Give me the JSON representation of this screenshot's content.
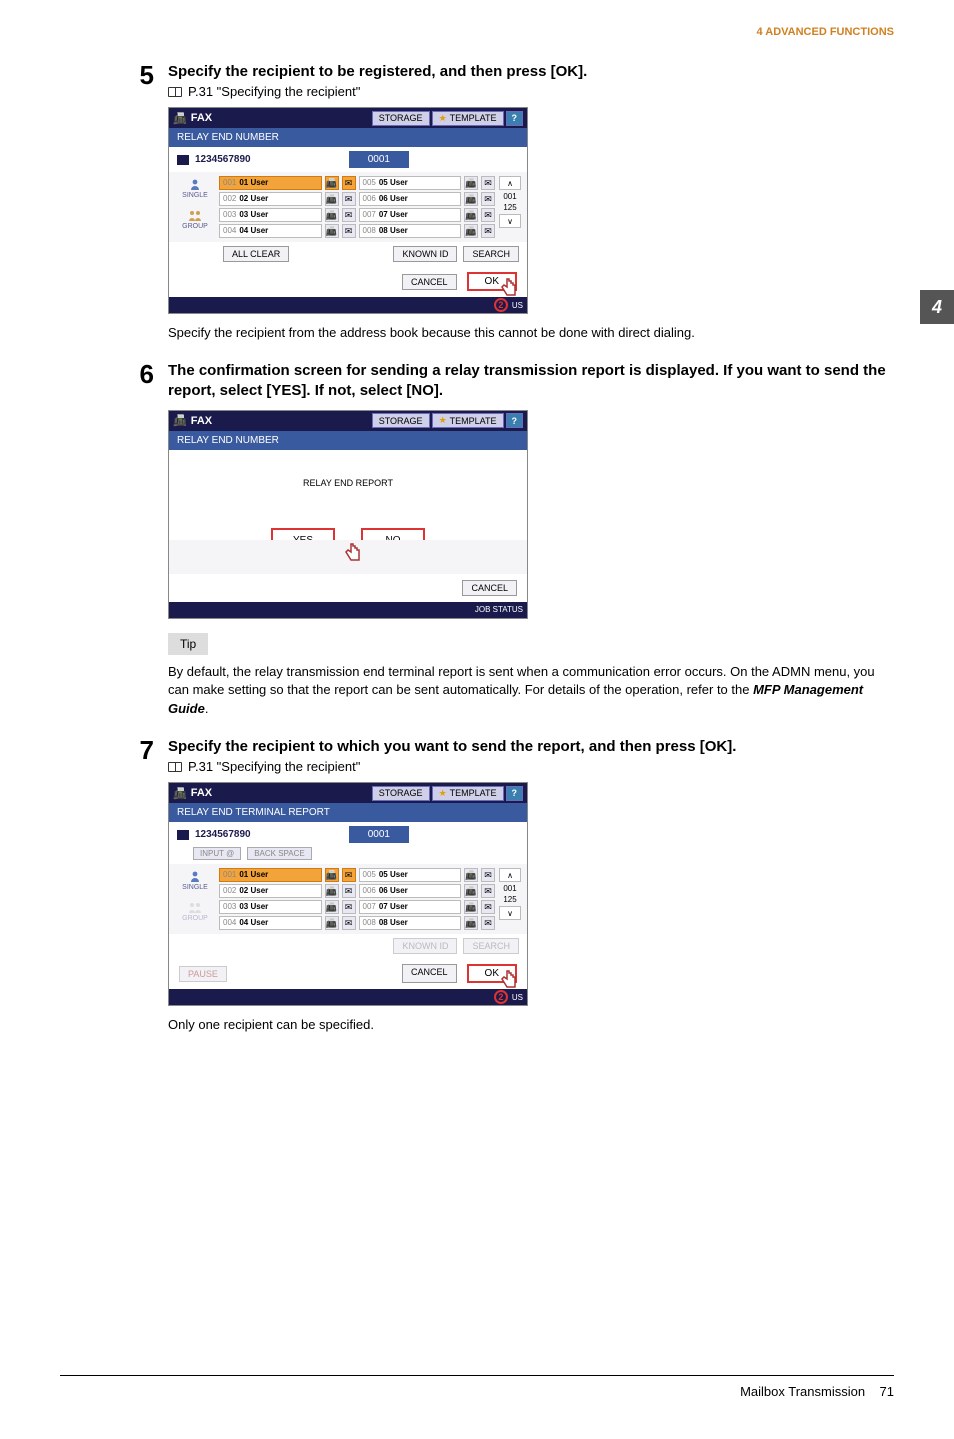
{
  "header": {
    "section_title": "4 ADVANCED FUNCTIONS"
  },
  "side_tab": {
    "label": "4"
  },
  "footer": {
    "chapter": "Mailbox Transmission",
    "page_num": "71"
  },
  "step5": {
    "num": "5",
    "title": "Specify the recipient to be registered, and then press [OK].",
    "link": " P.31 \"Specifying the recipient\"",
    "after_text": "Specify the recipient from the address book because this cannot be done with direct dialing."
  },
  "step6": {
    "num": "6",
    "title": "The confirmation screen for sending a relay transmission report is displayed. If you want to send the report, select [YES]. If not, select [NO]."
  },
  "tip": {
    "label": "Tip",
    "text": "By default, the relay transmission end terminal report is sent when a communication error occurs. On the ADMN menu, you can make setting so that the report can be sent automatically. For details of the operation, refer to the ",
    "ref": "MFP Management Guide",
    "period": "."
  },
  "step7": {
    "num": "7",
    "title": "Specify the recipient to which you want to send the report, and then press [OK].",
    "link": " P.31 \"Specifying the recipient\"",
    "after_text": "Only one recipient can be specified."
  },
  "screenA": {
    "fax": "FAX",
    "storage": "STORAGE",
    "template": "TEMPLATE",
    "help": "?",
    "subtitle": "RELAY END NUMBER",
    "fax_number": "1234567890",
    "selected": "0001",
    "side_single": "SINGLE",
    "side_group": "GROUP",
    "rows": [
      {
        "a_id": "001",
        "a_name": "01 User",
        "b_id": "005",
        "b_name": "05 User"
      },
      {
        "a_id": "002",
        "a_name": "02 User",
        "b_id": "006",
        "b_name": "06 User"
      },
      {
        "a_id": "003",
        "a_name": "03 User",
        "b_id": "007",
        "b_name": "07 User"
      },
      {
        "a_id": "004",
        "a_name": "04 User",
        "b_id": "008",
        "b_name": "08 User"
      }
    ],
    "page_start": "001",
    "page_end": "125",
    "all_clear": "ALL CLEAR",
    "known_id": "KNOWN ID",
    "search": "SEARCH",
    "cancel": "CANCEL",
    "ok": "OK",
    "status_ring": "2",
    "status": "US"
  },
  "screenB": {
    "fax": "FAX",
    "storage": "STORAGE",
    "template": "TEMPLATE",
    "help": "?",
    "subtitle": "RELAY END NUMBER",
    "prompt": "RELAY END REPORT",
    "yes": "YES",
    "no": "NO",
    "cancel": "CANCEL",
    "job_status": "JOB STATUS"
  },
  "screenC": {
    "fax": "FAX",
    "storage": "STORAGE",
    "template": "TEMPLATE",
    "help": "?",
    "subtitle": "RELAY END TERMINAL REPORT",
    "fax_number": "1234567890",
    "selected": "0001",
    "input_at": "INPUT @",
    "back_space": "BACK SPACE",
    "side_single": "SINGLE",
    "side_group": "GROUP",
    "rows": [
      {
        "a_id": "001",
        "a_name": "01 User",
        "b_id": "005",
        "b_name": "05 User"
      },
      {
        "a_id": "002",
        "a_name": "02 User",
        "b_id": "006",
        "b_name": "06 User"
      },
      {
        "a_id": "003",
        "a_name": "03 User",
        "b_id": "007",
        "b_name": "07 User"
      },
      {
        "a_id": "004",
        "a_name": "04 User",
        "b_id": "008",
        "b_name": "08 User"
      }
    ],
    "page_start": "001",
    "page_end": "125",
    "known_id": "KNOWN ID",
    "search": "SEARCH",
    "pause": "PAUSE",
    "cancel": "CANCEL",
    "ok": "OK",
    "status_ring": "2",
    "status": "US"
  }
}
